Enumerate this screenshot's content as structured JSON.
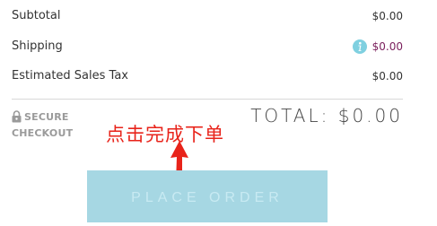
{
  "summary": {
    "subtotal": {
      "label": "Subtotal",
      "value": "$0.00"
    },
    "shipping": {
      "label": "Shipping",
      "value": "$0.00",
      "info_icon": "info-icon"
    },
    "tax": {
      "label": "Estimated Sales Tax",
      "value": "$0.00"
    }
  },
  "secure": {
    "line1": "SECURE",
    "line2": "CHECKOUT",
    "icon": "lock-icon"
  },
  "total": {
    "text": "TOTAL: $0.00"
  },
  "annotation": {
    "text": "点击完成下单",
    "color": "#e8231a"
  },
  "place_order": {
    "label": "PLACE ORDER",
    "background": "#a6d7e3"
  }
}
